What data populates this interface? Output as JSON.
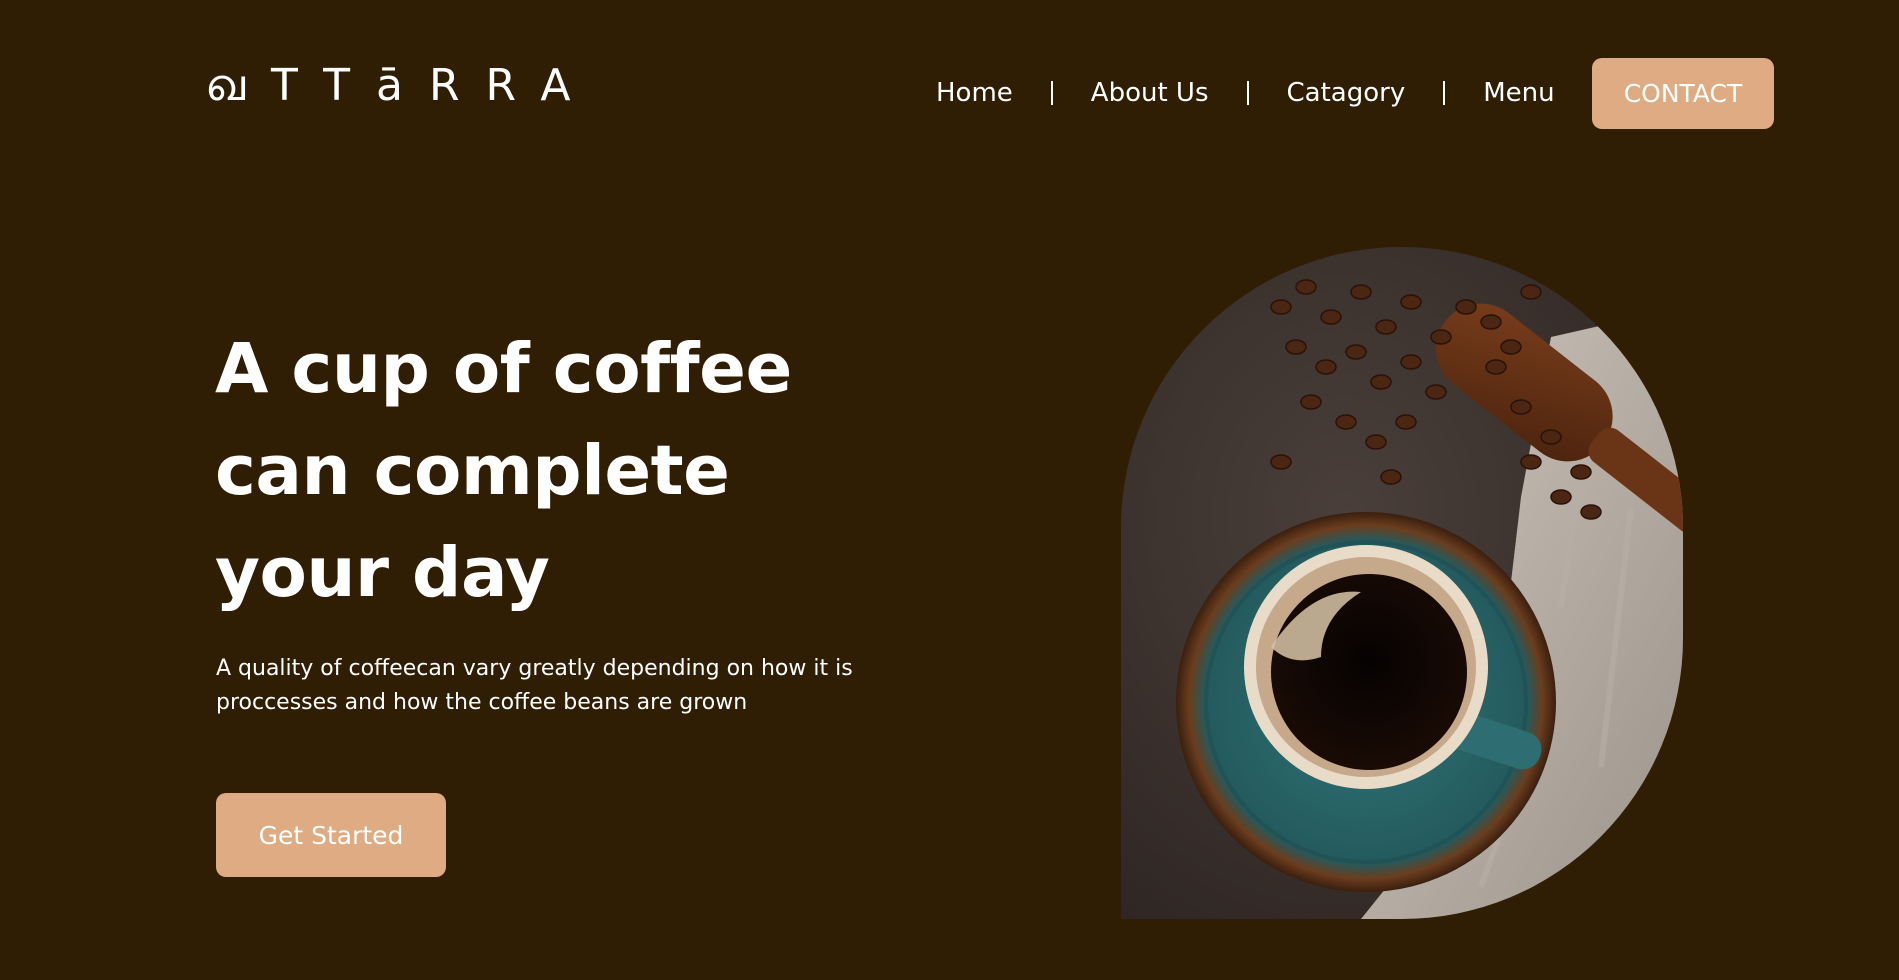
{
  "header": {
    "logo_text": "ഖTTāRRA",
    "nav": [
      {
        "label": "Home"
      },
      {
        "label": "About Us"
      },
      {
        "label": "Catagory"
      },
      {
        "label": "Menu"
      }
    ],
    "contact_label": "CONTACT"
  },
  "hero": {
    "title_line1": "A cup of coffee",
    "title_line2": "can complete",
    "title_line3": "your day",
    "subtitle": "A quality of coffeecan vary greatly depending on how it is proccesses and how the coffee beans are grown",
    "cta_label": "Get Started"
  },
  "colors": {
    "background": "#301e04",
    "accent": "#deab82",
    "text": "#ffffff"
  }
}
